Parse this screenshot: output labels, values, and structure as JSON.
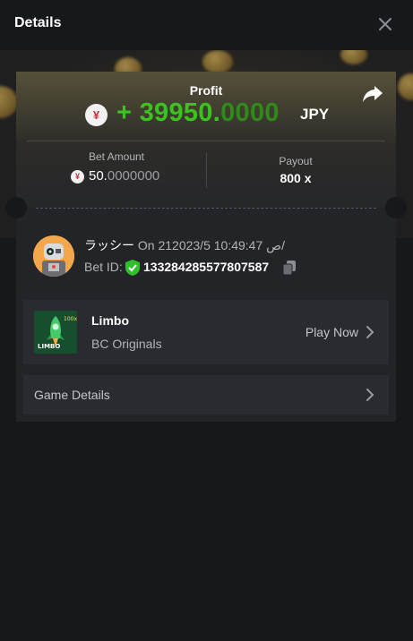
{
  "header": {
    "title": "Details"
  },
  "profit": {
    "label": "Profit",
    "currency_symbol": "¥",
    "amount_int": "+ 39950.",
    "amount_dec": "0000",
    "currency": "JPY"
  },
  "bet": {
    "label": "Bet Amount",
    "currency_symbol": "¥",
    "amount_int": "50.",
    "amount_dec": "0000000"
  },
  "payout": {
    "label": "Payout",
    "value": "800 x"
  },
  "user": {
    "name": "ラッシー",
    "time_text": "On 21ص 10:49:47 2023/5/",
    "bet_id_label": "Bet ID:",
    "bet_id": "133284285577807587"
  },
  "game": {
    "title": "Limbo",
    "provider": "BC Originals",
    "play_label": "Play Now",
    "thumb_text": "LIMBO",
    "thumb_badge": "100x"
  },
  "details": {
    "label": "Game Details"
  },
  "colors": {
    "profit_green": "#3cc21f",
    "background": "#17181b",
    "card": "#232428"
  }
}
